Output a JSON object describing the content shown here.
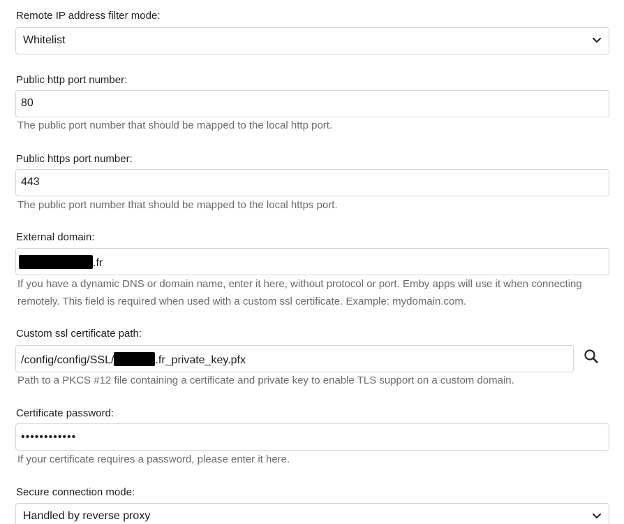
{
  "fields": {
    "filter_mode": {
      "label": "Remote IP address filter mode:",
      "value": "Whitelist"
    },
    "http_port": {
      "label": "Public http port number:",
      "value": "80",
      "help": "The public port number that should be mapped to the local http port."
    },
    "https_port": {
      "label": "Public https port number:",
      "value": "443",
      "help": "The public port number that should be mapped to the local https port."
    },
    "external_domain": {
      "label": "External domain:",
      "value_suffix": ".fr",
      "help": "If you have a dynamic DNS or domain name, enter it here, without protocol or port. Emby apps will use it when connecting remotely. This field is required when used with a custom ssl certificate. Example: mydomain.com."
    },
    "ssl_cert_path": {
      "label": "Custom ssl certificate path:",
      "value_prefix": "/config/config/SSL/",
      "value_suffix": ".fr_private_key.pfx",
      "help": "Path to a PKCS #12 file containing a certificate and private key to enable TLS support on a custom domain."
    },
    "cert_password": {
      "label": "Certificate password:",
      "value": "••••••••••••",
      "help": "If your certificate requires a password, please enter it here."
    },
    "secure_mode": {
      "label": "Secure connection mode:",
      "value": "Handled by reverse proxy"
    }
  },
  "icons": {
    "dropdown": "chevron-down-icon",
    "browse": "search-icon"
  },
  "colors": {
    "border": "#d6d6d6",
    "help_text": "#6a6a6a",
    "redaction": "#000000"
  }
}
